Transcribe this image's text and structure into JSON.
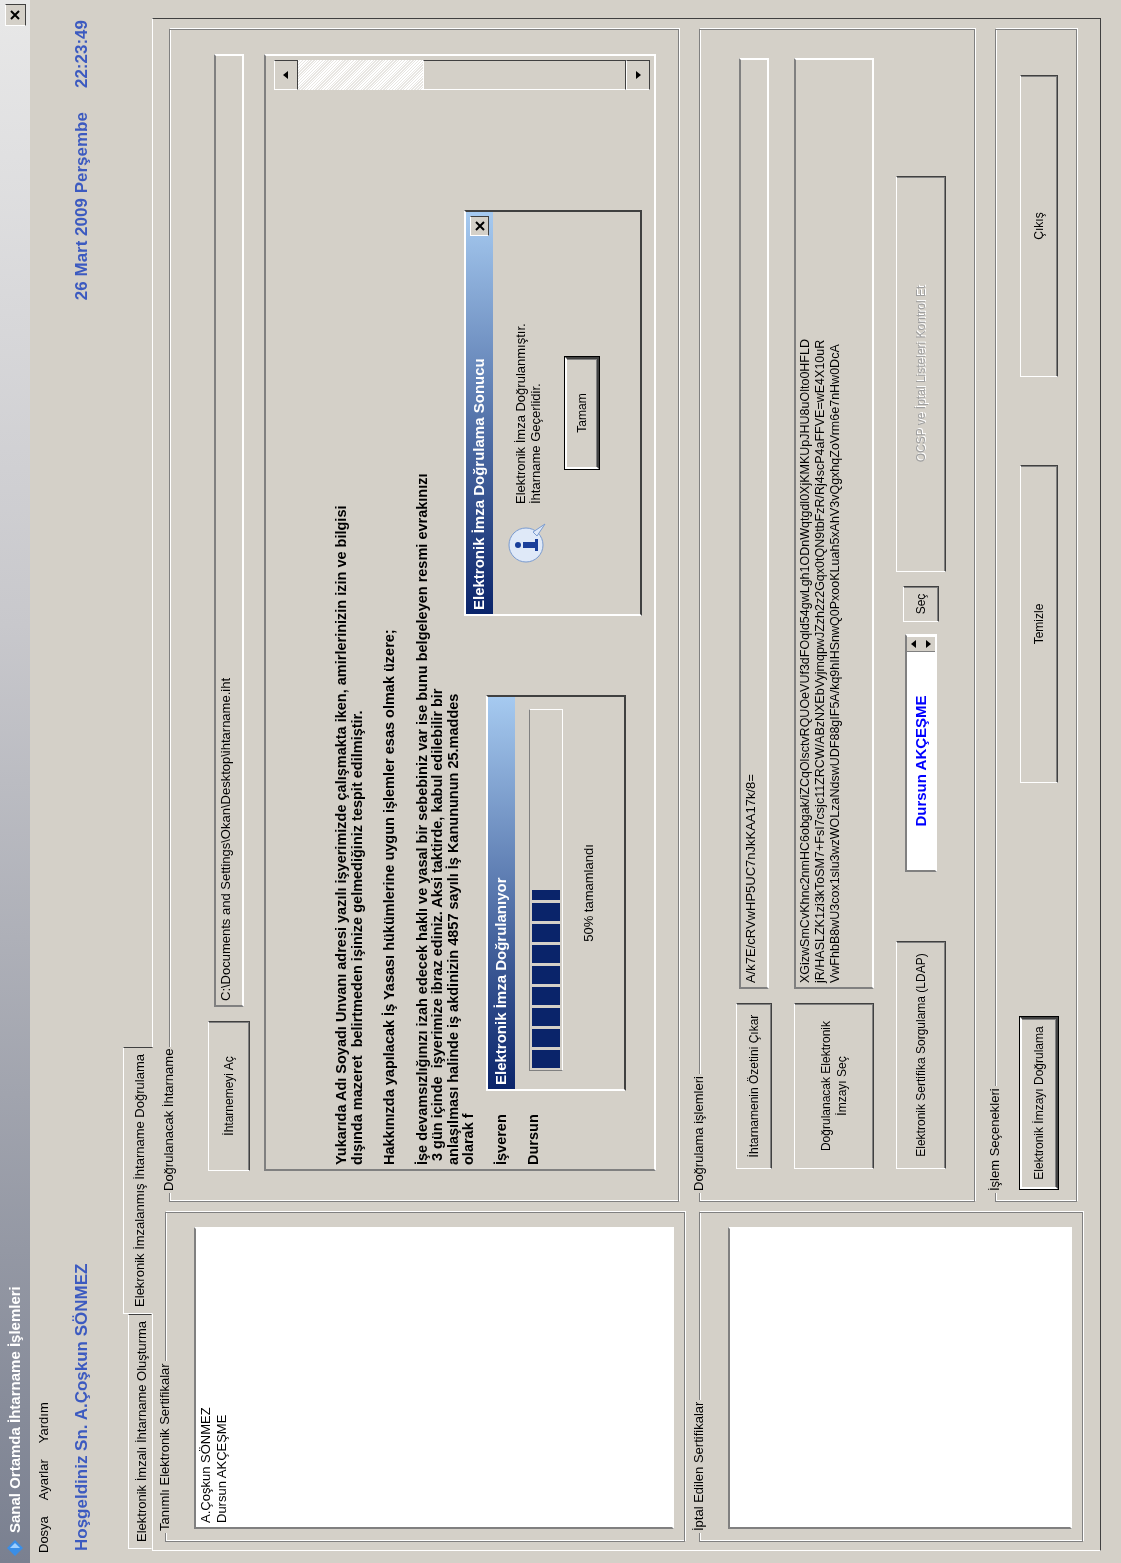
{
  "window": {
    "title": "Sanal Ortamda İhtarname İşlemleri"
  },
  "menu": [
    "Dosya",
    "Ayarlar",
    "Yardım"
  ],
  "header": {
    "welcome": "Hoşgeldiniz Sn. A.Çoşkun SÖNMEZ",
    "date": "26 Mart 2009 Perşembe",
    "time": "22:23:49"
  },
  "tabs": [
    {
      "label": "Elektronik İmzalı İhtarname Oluşturma",
      "selected": false
    },
    {
      "label": "Elekronik İmzalanmış İhtarname Doğrulama",
      "selected": true
    }
  ],
  "certificates": {
    "title": "Tanımlı Elektronik Sertifikalar",
    "items": [
      "A.Çoşkun SÖNMEZ",
      "Dursun AKÇEŞME"
    ]
  },
  "revoked": {
    "title": "İptal Edilen Sertifikalar"
  },
  "document": {
    "title": "Doğrulanacak İhtarname",
    "open_button": "İhtarnemeyi Aç",
    "path": "C:\\Documents and Settings\\Okan\\Desktop\\ihtarname.iht",
    "paragraphs": [
      [
        "Yukarıda Adı Soyadı Unvanı adresi yazılı işyerimizde çalışmakta iken, amirlerinizin izin ve bilgisi",
        "dışında mazeret  belirtmeden işinize gelmediğiniz tespit edilmiştir."
      ],
      [
        "Hakkınızda yapılacak İş Yasası hükümlerine uygun işlemler esas olmak üzere;"
      ],
      [
        "İşe devamsızlığınızı izah edecek haklı ve yasal bir sebebiniz var ise bunu belgeleyen resmi evrakınızı",
        " 3 gün içinde  işyerimize ibraz ediniz. Aksi taktirde, kabul edilebilir bir",
        "anlaşılması halinde iş akdinizin 4857 sayılı İş Kanununun 25.maddes",
        "olarak f"
      ],
      [
        "İşveren"
      ],
      [
        "Dursun"
      ]
    ]
  },
  "progress_dialog": {
    "title": "Elektronik İmza Doğrulanıyor",
    "level": 0.5,
    "caption": "50% tamamlandı"
  },
  "result_dialog": {
    "title": "Elektronik İmza Doğrulama Sonucu",
    "message": [
      "Elektronik İmza Doğrulanmıştır.",
      "İhtarname Geçerlidir."
    ],
    "button": "Tamam"
  },
  "verification": {
    "title": "Doğrulama işlemleri",
    "digest_button": "İhtarnamenin Özetini Çıkar",
    "digest": "A/k7E/cRVwHP5UC7nJkKAA17k/8=",
    "signature_button": "Doğrulanacak Elektronik İmzayı Seç",
    "signature_lines": [
      "XGizwSmCvKhnc2nmHC6obgak/iZCqOlsctvRQUOeVUf3dFOqld54gwLgh1ODnWqtgdl0XjKMKUpJHU8uOlto0HFLD",
      "jR/HASLZK1zi3kToSM7+FsI7csjc11ZRCW/ABzNXEbVyjmqpwJZzh2z2Gqx0tQN9tbFzR/Rj4scP4aFFVE=wE4X10uR",
      "VwFhbB8wU3cox1slu3wzWOLzaNdswUDF88gIF5A/kq9hIHSnwQ0PxooKLuah5xAhV3vQgxhqZoVrm6e7nHw0DcA"
    ],
    "ldap_button": "Elektronik Sertifika Sorgulama (LDAP)",
    "selected_certificate": "Dursun AKÇEŞME",
    "select_button": "Seç",
    "ocsp_button": {
      "label": "OCSP ve İptal Listeleri Kontrol Et",
      "disabled": true
    }
  },
  "actions": {
    "title": "İşlem Seçenekleri",
    "buttons": [
      {
        "label": "Elektronik İmzayı Doğrulama",
        "default": true
      },
      {
        "label": "Temizle",
        "default": false
      },
      {
        "label": "Çıkış",
        "default": false
      }
    ]
  }
}
